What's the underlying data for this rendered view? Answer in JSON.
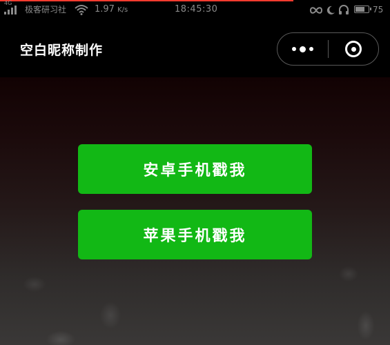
{
  "status_bar": {
    "network_type": "4G",
    "carrier": "极客研习社",
    "speed_value": "1.97",
    "speed_unit": "K/s",
    "time": "18:45:30",
    "battery_percent": "75",
    "battery_level": 0.75,
    "icons": [
      "signal-icon",
      "wifi-icon",
      "infinity-icon",
      "moon-icon",
      "headphone-icon",
      "battery-icon"
    ]
  },
  "nav": {
    "title": "空白昵称制作",
    "menu_icon": "more-dots-icon",
    "close_icon": "close-target-icon"
  },
  "buttons": {
    "android_label": "安卓手机戳我",
    "iphone_label": "苹果手机戳我"
  },
  "colors": {
    "button_green": "#12b815",
    "status_text": "#8b8b8b",
    "progress_red": "#ff3b2f"
  }
}
